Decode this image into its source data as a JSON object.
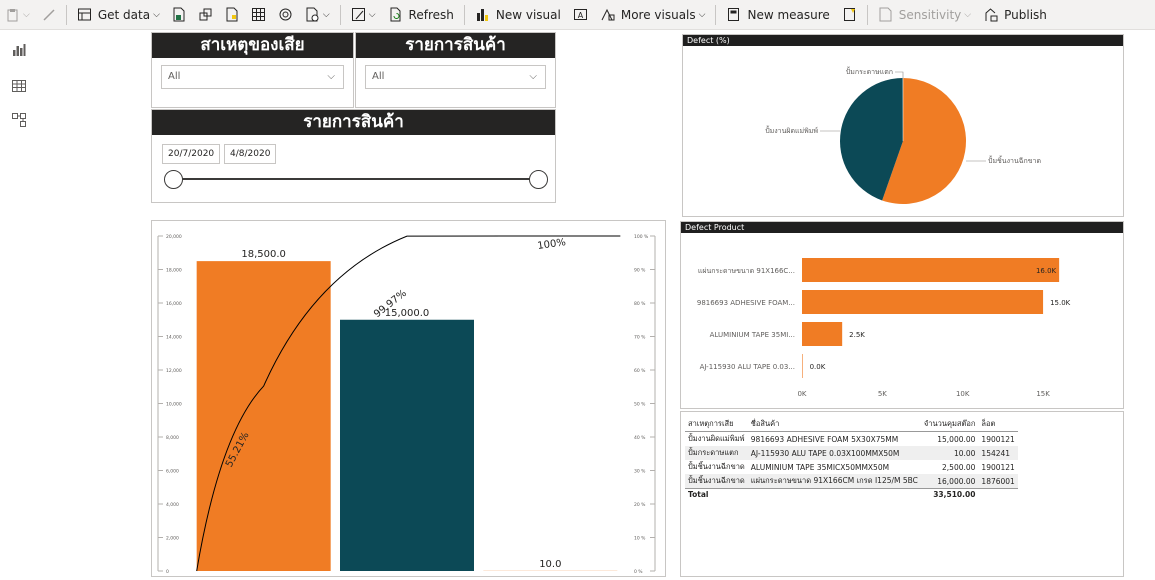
{
  "ribbon": {
    "items": [
      {
        "label": "Get data",
        "icon": "database-icon",
        "caret": true
      },
      {
        "label": "Refresh",
        "icon": "refresh-icon",
        "caret": false
      },
      {
        "label": "New visual",
        "icon": "new-visual-icon",
        "caret": false
      },
      {
        "label": "More visuals",
        "icon": "more-visuals-icon",
        "caret": true
      },
      {
        "label": "New measure",
        "icon": "calculator-icon",
        "caret": false
      },
      {
        "label": "Sensitivity",
        "icon": "sensitivity-icon",
        "caret": true,
        "disabled": true
      },
      {
        "label": "Publish",
        "icon": "publish-icon",
        "caret": false
      }
    ]
  },
  "rail": {
    "icons": [
      "report-view-icon",
      "data-view-icon",
      "model-view-icon"
    ]
  },
  "slicers": {
    "reason": {
      "title": "สาเหตุของเสีย",
      "value": "All"
    },
    "product": {
      "title": "รายการสินค้า",
      "value": "All"
    },
    "date": {
      "title": "รายการสินค้า",
      "start": "20/7/2020",
      "end": "4/8/2020"
    }
  },
  "colors": {
    "orange": "#f07c24",
    "teal": "#0c4956",
    "header": "#252423",
    "accent_line": "#000000"
  },
  "chart_data": [
    {
      "type": "bar",
      "title": "",
      "categories": [
        "",
        "",
        ""
      ],
      "series": [
        {
          "values": [
            18500,
            15000,
            10
          ]
        },
        {
          "type": "line",
          "values": [
            55.21,
            99.97,
            100
          ]
        }
      ],
      "bar_labels": [
        "18,500.0",
        "15,000.0",
        "10.0"
      ],
      "line_labels": [
        "55.21%",
        "99.97%",
        "100%"
      ],
      "ylim": [
        0,
        20000
      ],
      "y2lim": [
        0,
        100
      ],
      "y_ticks": [
        "0",
        "2,000",
        "4,000",
        "6,000",
        "8,000",
        "10,000",
        "12,000",
        "14,000",
        "16,000",
        "18,000",
        "20,000"
      ],
      "y2_ticks": [
        "0 %",
        "10 %",
        "20 %",
        "30 %",
        "40 %",
        "50 %",
        "60 %",
        "70 %",
        "80 %",
        "90 %",
        "100 %"
      ]
    },
    {
      "type": "pie",
      "title": "Defect (%)",
      "labels": [
        "ปั้มงานผิดแม่พิมพ์",
        "ปั้มชิ้นงานฉีกขาด",
        "ปั้มกระดาษแตก"
      ],
      "values": [
        44.6,
        55.4,
        0.05
      ]
    },
    {
      "type": "bar",
      "orientation": "horizontal",
      "title": "Defect Product",
      "categories": [
        "แผ่นกระดาษขนาด 91X166C...",
        "9816693 ADHESIVE FOAM...",
        "ALUMINIUM TAPE 35MI...",
        "AJ-115930 ALU TAPE 0.03..."
      ],
      "values": [
        16000,
        15000,
        2500,
        10
      ],
      "value_labels": [
        "16.0K",
        "15.0K",
        "2.5K",
        "0.0K"
      ],
      "x_ticks": [
        "0K",
        "5K",
        "10K",
        "15K"
      ],
      "xlim": [
        0,
        16800
      ]
    }
  ],
  "table": {
    "columns": [
      "สาเหตุการเสีย",
      "ชื่อสินค้า",
      "จำนวนคุมสต๊อก",
      "ล็อต"
    ],
    "rows": [
      [
        "ปั้มงานผิดแม่พิมพ์",
        "9816693 ADHESIVE FOAM 5X30X75MM",
        "15,000.00",
        "1900121"
      ],
      [
        "ปั้มกระดาษแตก",
        "AJ-115930 ALU TAPE 0.03X100MMX50M",
        "10.00",
        "154241"
      ],
      [
        "ปั้มชิ้นงานฉีกขาด",
        "ALUMINIUM TAPE 35MICX50MMX50M",
        "2,500.00",
        "1900121"
      ],
      [
        "ปั้มชิ้นงานฉีกขาด",
        "แผ่นกระดาษขนาด 91X166CM เกรด I125/M 5BC",
        "16,000.00",
        "1876001"
      ]
    ],
    "total_label": "Total",
    "total_value": "33,510.00"
  }
}
